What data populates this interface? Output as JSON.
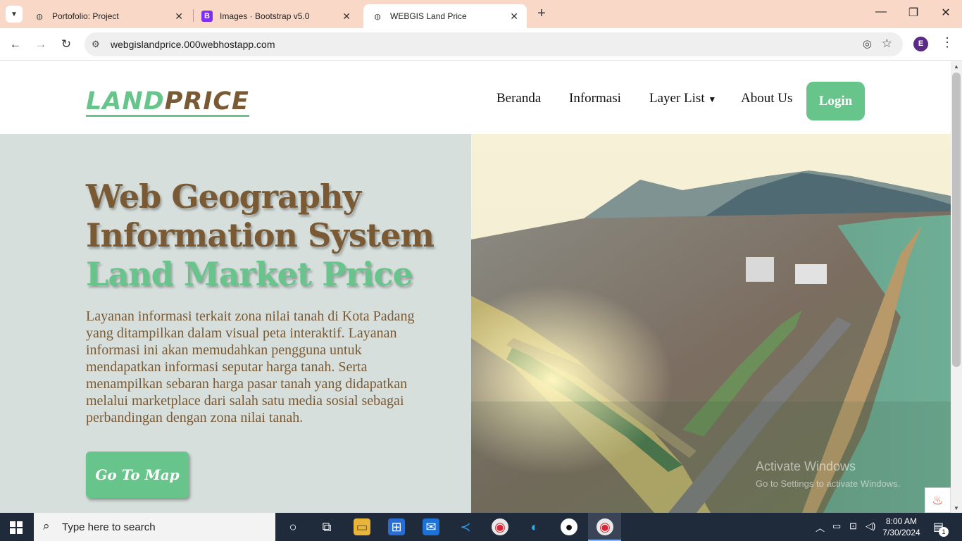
{
  "browser": {
    "tabs": [
      {
        "title": "Portofolio: Project",
        "favicon": "globe-icon"
      },
      {
        "title": "Images · Bootstrap v5.0",
        "favicon": "bootstrap-icon",
        "favicon_letter": "B"
      },
      {
        "title": "WEBGIS Land Price",
        "favicon": "globe-icon",
        "active": true
      }
    ],
    "url": "webgislandprice.000webhostapp.com",
    "profile_initial": "E"
  },
  "site": {
    "logo_part1": "LAND",
    "logo_part2": "PRICE",
    "nav": [
      "Beranda",
      "Informasi",
      "Layer List",
      "About Us"
    ],
    "login_label": "Login",
    "headline_line1": "Web Geography",
    "headline_line2": "Information System",
    "headline_line3": "Land Market Price",
    "description": "Layanan informasi terkait zona nilai tanah di Kota Padang yang ditampilkan dalam visual peta interaktif. Layanan informasi ini akan memudahkan pengguna untuk mendapatkan informasi seputar harga tanah. Serta menampilkan sebaran harga pasar tanah yang didapatkan melalui marketplace dari salah satu media sosial sebagai perbandingan dengan zona nilai tanah.",
    "cta_label": "Go To Map",
    "hero_image": "aerial-city-coast-photo"
  },
  "watermark": {
    "line1": "Activate Windows",
    "line2": "Go to Settings to activate Windows."
  },
  "taskbar": {
    "search_placeholder": "Type here to search",
    "time": "8:00 AM",
    "date": "7/30/2024",
    "notification_count": "1"
  },
  "colors": {
    "accent_green": "#67c48b",
    "brand_brown": "#7a5a35",
    "hero_bg": "#d6dfdc",
    "tabbar_bg": "#f9d8c7"
  }
}
